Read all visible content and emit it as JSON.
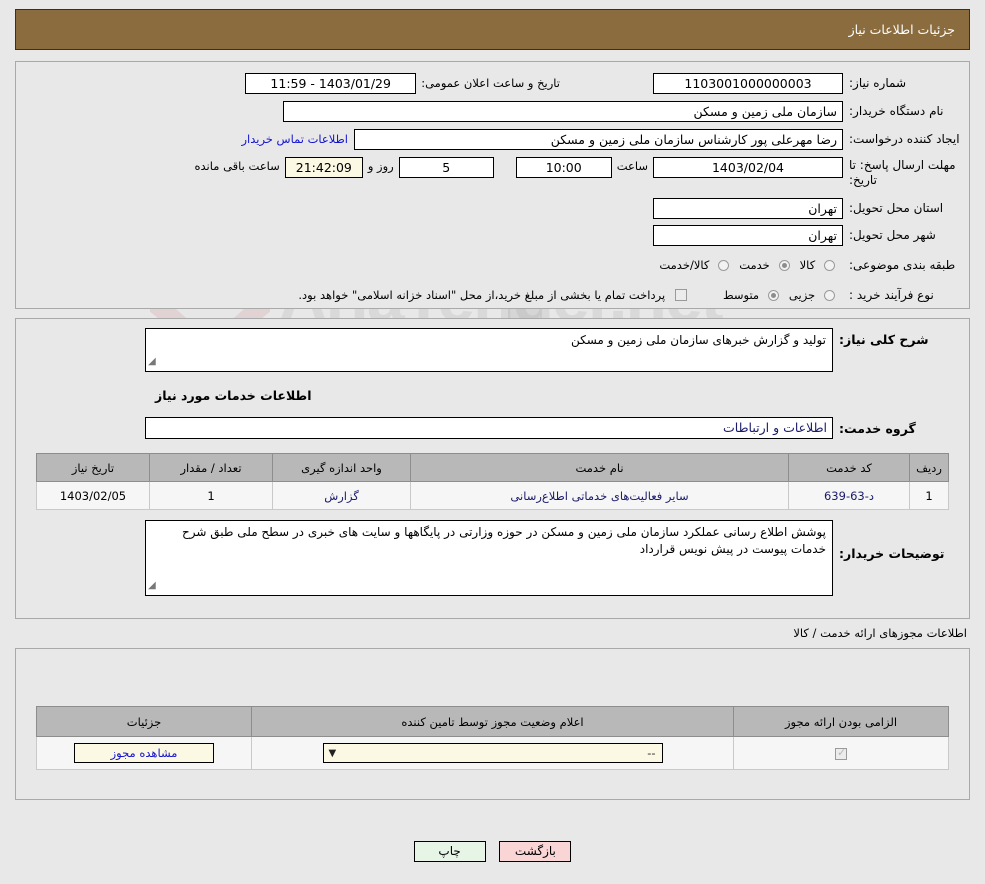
{
  "header": {
    "title": "جزئیات اطلاعات نیاز"
  },
  "basic": {
    "need_no_label": "شماره نیاز:",
    "need_no_value": "1103001000000003",
    "announce_label": "تاریخ و ساعت اعلان عمومی:",
    "announce_value": "1403/01/29 - 11:59",
    "buyer_org_label": "نام دستگاه خریدار:",
    "buyer_org_value": "سازمان ملی زمین و مسکن",
    "creator_label": "ایجاد کننده درخواست:",
    "creator_value": "رضا مهرعلی پور کارشناس سازمان ملی زمین و مسکن",
    "contact_link": "اطلاعات تماس خریدار",
    "deadline_label": "مهلت ارسال پاسخ: تا تاریخ:",
    "deadline_date": "1403/02/04",
    "hour_label": "ساعت",
    "deadline_time": "10:00",
    "days_value": "5",
    "days_label": "روز و",
    "countdown_value": "21:42:09",
    "remaining_label": "ساعت باقی مانده",
    "province_label": "استان محل تحویل:",
    "province_value": "تهران",
    "city_label": "شهر محل تحویل:",
    "city_value": "تهران",
    "category_label": "طبقه بندی موضوعی:",
    "category_options": [
      {
        "label": "کالا",
        "selected": false
      },
      {
        "label": "خدمت",
        "selected": true
      },
      {
        "label": "کالا/خدمت",
        "selected": false
      }
    ],
    "process_label": "نوع فرآیند خرید :",
    "process_options": [
      {
        "label": "جزیی",
        "selected": false
      },
      {
        "label": "متوسط",
        "selected": true
      }
    ],
    "treasury_checked": false,
    "treasury_text": "پرداخت تمام یا بخشی از مبلغ خرید،از محل \"اسناد خزانه اسلامی\" خواهد بود."
  },
  "need": {
    "summary_label": "شرح کلی نیاز:",
    "summary_value": "تولید و گزارش خبرهای سازمان ملی زمین و مسکن",
    "services_heading": "اطلاعات خدمات مورد نیاز",
    "service_group_label": "گروه خدمت:",
    "service_group_value": "اطلاعات و ارتباطات",
    "table": {
      "columns": [
        "ردیف",
        "کد خدمت",
        "نام خدمت",
        "واحد اندازه گیری",
        "تعداد / مقدار",
        "تاریخ نیاز"
      ],
      "rows": [
        {
          "row_no": "1",
          "service_code": "د-63-639",
          "service_name": "سایر فعالیت‌های خدماتی اطلاع‌رسانی",
          "unit": "گزارش",
          "quantity": "1",
          "need_date": "1403/02/05"
        }
      ]
    },
    "buyer_notes_label": "توضیحات خریدار:",
    "buyer_notes_value": "پوشش اطلاع رسانی عملکرد سازمان ملی زمین و مسکن در حوزه وزارتی در پایگاهها و سایت های خبری در سطح ملی طبق شرح خدمات پیوست در پیش نویس قرارداد"
  },
  "permits": {
    "heading": "اطلاعات مجوزهای ارائه خدمت / کالا",
    "columns": [
      "الزامی بودن ارائه مجوز",
      "اعلام وضعیت مجوز توسط تامین کننده",
      "جزئیات"
    ],
    "rows": [
      {
        "required_checked": true,
        "status_value": "--",
        "details_label": "مشاهده مجوز"
      }
    ]
  },
  "footer": {
    "back_label": "بازگشت",
    "print_label": "چاپ"
  },
  "watermark": {
    "text": "AriaTender.net"
  }
}
